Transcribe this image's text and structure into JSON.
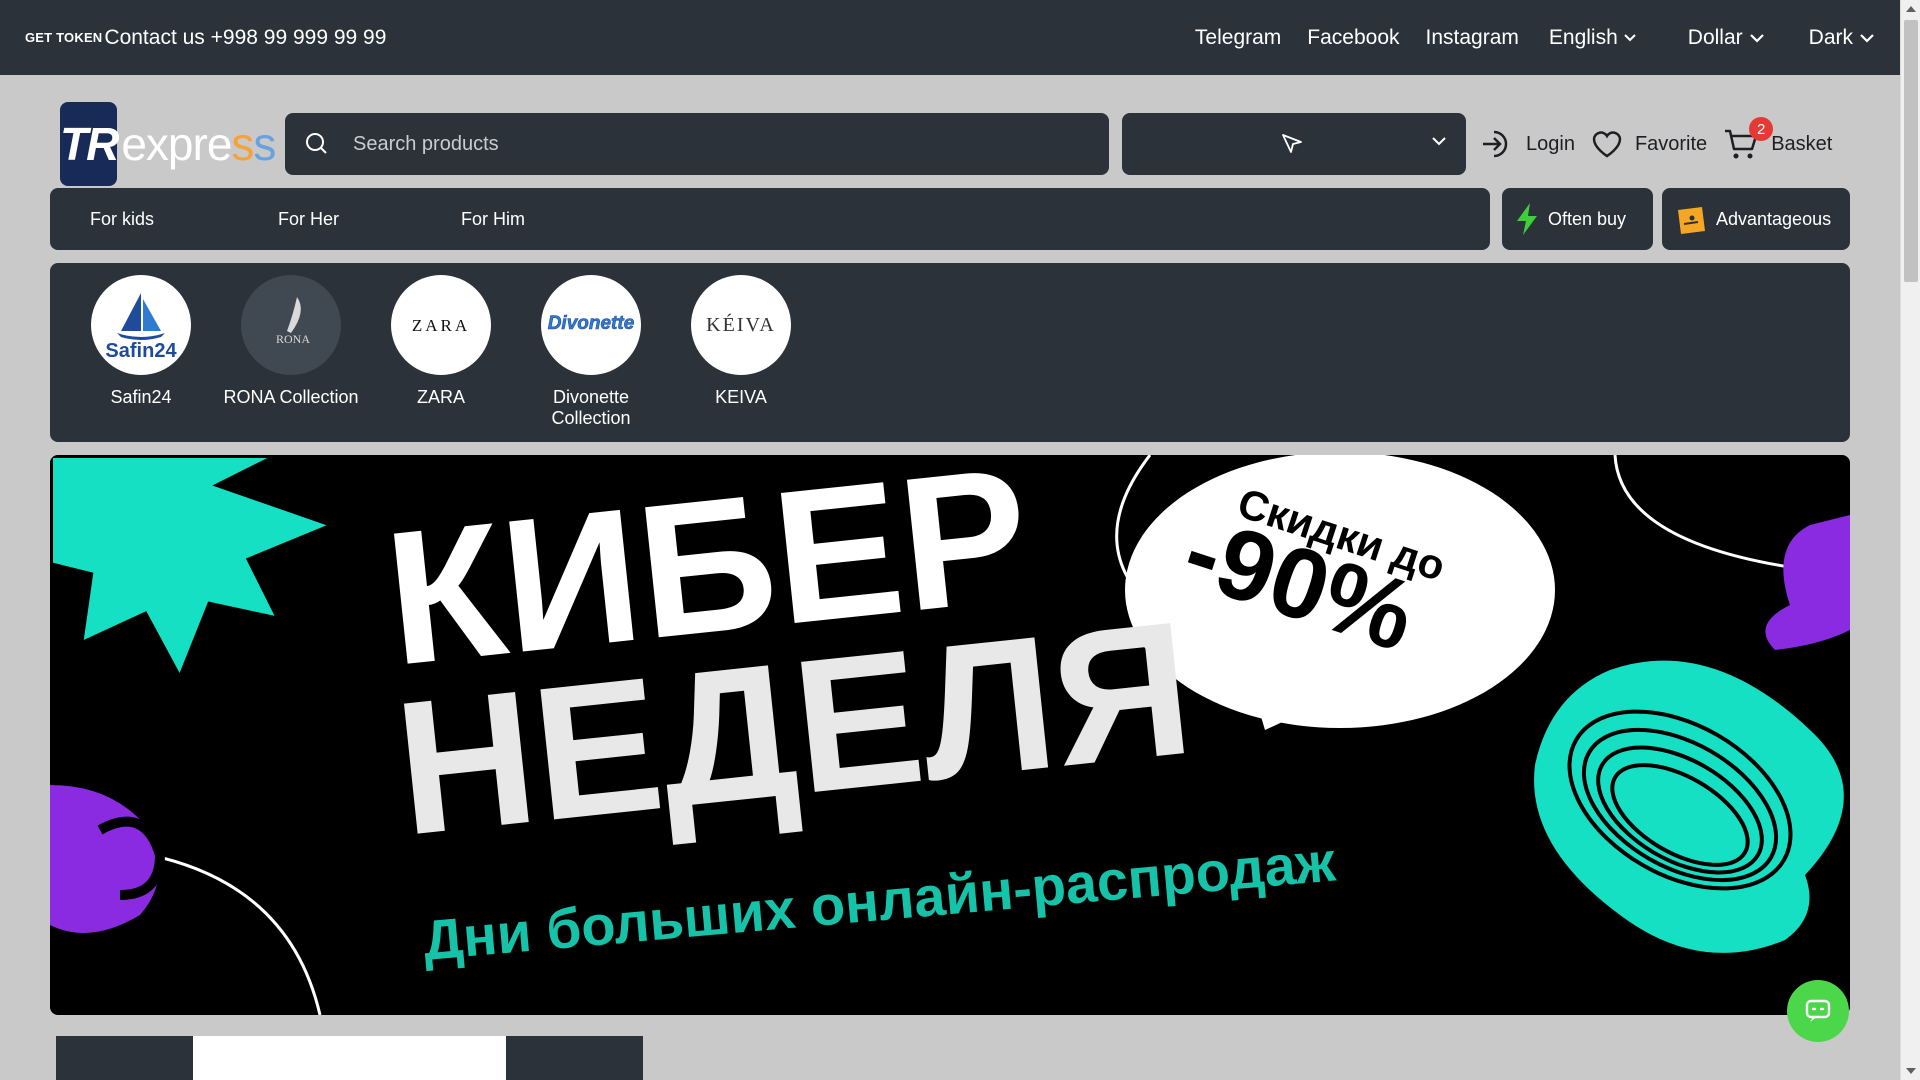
{
  "topbar": {
    "get_token": "GET TOKEN",
    "contact": "Contact us +998 99 999 99 99",
    "links": [
      "Telegram",
      "Facebook",
      "Instagram"
    ],
    "language": "English",
    "currency": "Dollar",
    "theme": "Dark"
  },
  "header": {
    "logo_initials": "TR",
    "logo_word_1": "expre",
    "logo_word_2": "s",
    "logo_word_3": "s",
    "search_placeholder": "Search products",
    "login_label": "Login",
    "favorite_label": "Favorite",
    "basket_label": "Basket",
    "basket_count": "2"
  },
  "nav": {
    "items": [
      "For kids",
      "For Her",
      "For Him"
    ],
    "often_buy": "Often buy",
    "advantageous": "Advantageous"
  },
  "brands": [
    {
      "name": "Safin24",
      "logo_text": "Safin24"
    },
    {
      "name": "RONA Collection",
      "logo_text": "RONA"
    },
    {
      "name": "ZARA",
      "logo_text": "ZARA"
    },
    {
      "name": "Divonette Collection",
      "logo_text": "Divonette"
    },
    {
      "name": "KEIVA",
      "logo_text": "KÉIVA"
    }
  ],
  "banner": {
    "line1": "КИБЕР",
    "line2": "НЕДЕЛЯ",
    "badge_top": "Скидки до",
    "badge_value": "-90%",
    "subtitle": "Дни больших онлайн-распродаж"
  },
  "colors": {
    "bar": "#2b323a",
    "page_bg": "#c9c9c9",
    "accent_green": "#4cd64a",
    "badge_red": "#e53935",
    "banner_teal": "#16e0c4",
    "banner_purple": "#8a2be2"
  }
}
